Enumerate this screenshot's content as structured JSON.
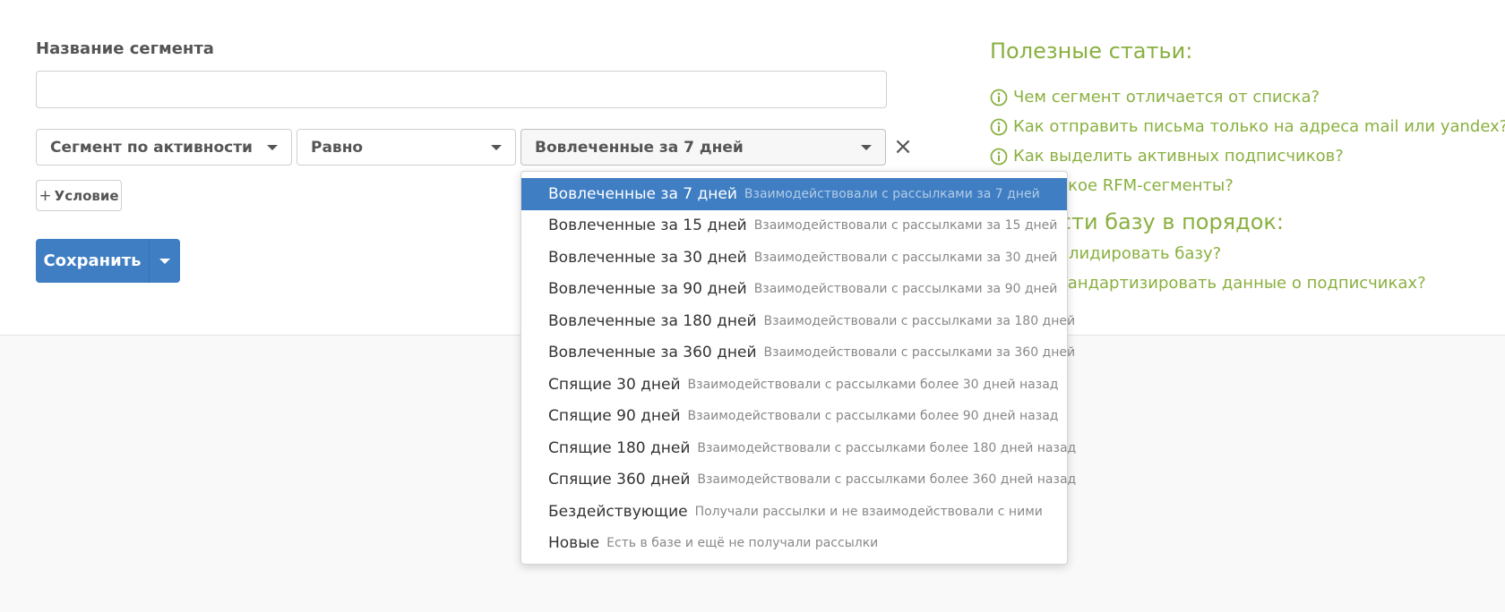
{
  "form": {
    "segment_name_label": "Название сегмента",
    "segment_name_value": "",
    "condition": {
      "field_select": "Сегмент по активности",
      "operator_select": "Равно",
      "value_select": "Вовлеченные за 7 дней",
      "remove_label": "×"
    },
    "add_condition_plus": "+",
    "add_condition_label": "Условие",
    "save_label": "Сохранить"
  },
  "sidebar": {
    "heading1": "Полезные статьи:",
    "links1": [
      "Чем сегмент отличается от списка?",
      "Как отправить письма только на адреса mail или yandex?",
      "Как выделить активных подписчиков?",
      "Что такое RFM-сегменты?"
    ],
    "heading2": "Привести базу в порядок:",
    "links2": [
      "Как валидировать базу?",
      "Как стандартизировать данные о подписчиках?"
    ]
  },
  "dropdown": {
    "options": [
      {
        "title": "Вовлеченные за 7 дней",
        "desc": "Взаимодействовали с рассылками за 7 дней",
        "active": true
      },
      {
        "title": "Вовлеченные за 15 дней",
        "desc": "Взаимодействовали с рассылками за 15 дней"
      },
      {
        "title": "Вовлеченные за 30 дней",
        "desc": "Взаимодействовали с рассылками за 30 дней"
      },
      {
        "title": "Вовлеченные за 90 дней",
        "desc": "Взаимодействовали с рассылками за 90 дней"
      },
      {
        "title": "Вовлеченные за 180 дней",
        "desc": "Взаимодействовали с рассылками за 180 дней"
      },
      {
        "title": "Вовлеченные за 360 дней",
        "desc": "Взаимодействовали с рассылками за 360 дней"
      },
      {
        "title": "Спящие 30 дней",
        "desc": "Взаимодействовали с рассылками более 30 дней назад"
      },
      {
        "title": "Спящие 90 дней",
        "desc": "Взаимодействовали с рассылками более 90 дней назад"
      },
      {
        "title": "Спящие 180 дней",
        "desc": "Взаимодействовали с рассылками более 180 дней назад"
      },
      {
        "title": "Спящие 360 дней",
        "desc": "Взаимодействовали с рассылками более 360 дней назад"
      },
      {
        "title": "Бездействующие",
        "desc": "Получали рассылки и не взаимодействовали с ними"
      },
      {
        "title": "Новые",
        "desc": "Есть в базе и ещё не получали рассылки"
      }
    ]
  },
  "colors": {
    "accent_blue": "#3f7ec3",
    "link_green": "#8ab040"
  },
  "icons": {
    "info": "info-circle-icon",
    "caret": "caret-down-icon",
    "close": "close-icon"
  }
}
